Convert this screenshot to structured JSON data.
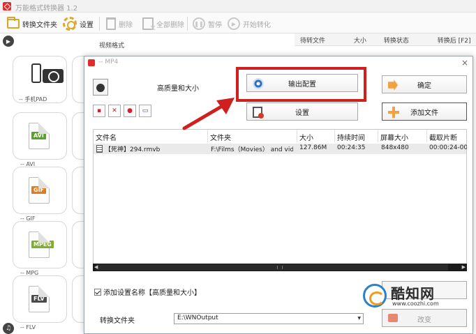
{
  "app": {
    "title": "万能格式转换器 1.2"
  },
  "toolbar": {
    "output_folder": "转换文件夹",
    "settings": "设置",
    "delete": "删除",
    "delete_all": "全部删除",
    "pause": "暂停",
    "start": "开始转化"
  },
  "sidebar": {
    "formats": [
      {
        "label": "-- 手机PAD",
        "icon": "mobile-devices-icon"
      },
      {
        "label": "-- AVI",
        "tag": "AVI",
        "color": "#5aa02c"
      },
      {
        "label": "-- GIF",
        "tag": "GIF",
        "color": "#e07b22"
      },
      {
        "label": "-- MPG",
        "tag": "MPEG",
        "color": "#7fae2a"
      },
      {
        "label": "-- FLV",
        "tag": "FLV",
        "color": "#4a4a4a"
      }
    ]
  },
  "main": {
    "video_format_label": "视频格式",
    "columns": [
      "待转文件",
      "大小",
      "转换状态",
      "转换后 [F2]"
    ]
  },
  "dialog": {
    "title": "-- MP4",
    "profile_name": "高质量和大小",
    "output_config_button": "输出配置",
    "settings_button": "设置",
    "ok_button": "确定",
    "add_file_button": "添加文件",
    "table": {
      "headers": [
        "文件名",
        "文件夹",
        "大小",
        "持续时间",
        "屏幕大小",
        "截取片断"
      ],
      "rows": [
        {
          "name": "【死神】294.rmvb",
          "folder": "F:\\Films（Movies） and vid...",
          "size": "127.86M",
          "duration": "00:24:35",
          "screen": "848x480",
          "clip": "00:00:24-00:..."
        }
      ]
    },
    "add_name_checkbox": "添加设置名称【高质量和大小】",
    "output_folder_label": "转换文件夹",
    "output_folder_value": "E:\\WNOutput",
    "browse_button": "改变"
  },
  "watermark": {
    "text": "酷知网",
    "url": "www.coozhi.com"
  },
  "colors": {
    "highlight": "#d01f1f",
    "accent": "#f2a144"
  }
}
